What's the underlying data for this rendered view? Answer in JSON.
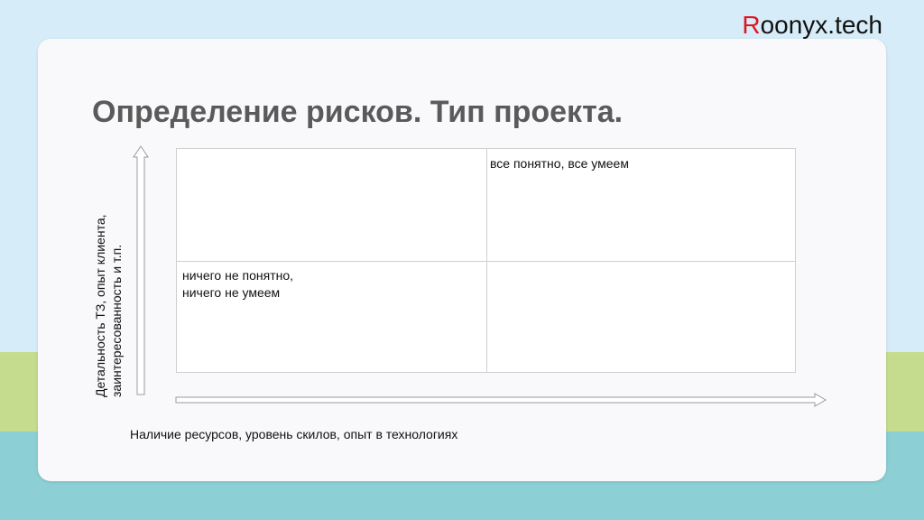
{
  "brand": {
    "first_letter": "R",
    "rest": "oonyx.tech"
  },
  "slide": {
    "title": "Определение рисков. Тип проекта.",
    "cells": {
      "top_right": "все понятно, все умеем",
      "bottom_left_line1": "ничего не понятно,",
      "bottom_left_line2": "ничего не умеем"
    },
    "y_axis": {
      "line1": "Детальность ТЗ, опыт клиента,",
      "line2": "заинтересованность и т.п."
    },
    "x_axis": "Наличие ресурсов, уровень скилов, опыт в технологиях"
  },
  "icons": {
    "up": "arrow-up-icon",
    "right": "arrow-right-icon"
  },
  "colors": {
    "brand_accent": "#e0141e",
    "title": "#5a5a5a",
    "green_band": "#c5dc8e",
    "teal_band": "#8ccfd5",
    "sky": "#d6ecf8"
  }
}
